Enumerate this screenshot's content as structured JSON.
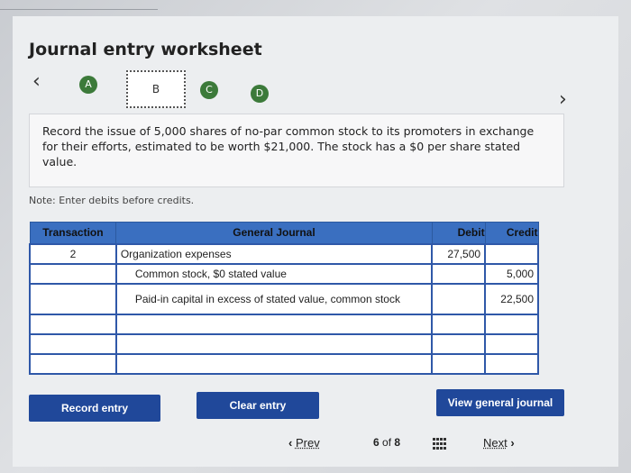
{
  "title": "Journal entry worksheet",
  "steps": [
    "A",
    "B",
    "C",
    "D"
  ],
  "instruction": "Record the issue of 5,000 shares of no-par common stock to its promoters in exchange for their efforts, estimated to be worth $21,000. The stock has a $0 per share stated value.",
  "note": "Note: Enter debits before credits.",
  "table": {
    "headers": [
      "Transaction",
      "General Journal",
      "Debit",
      "Credit"
    ],
    "rows": [
      {
        "txn": "2",
        "account": "Organization expenses",
        "debit": "27,500",
        "credit": ""
      },
      {
        "txn": "",
        "account": "Common stock, $0 stated value",
        "debit": "",
        "credit": "5,000"
      },
      {
        "txn": "",
        "account": "Paid-in capital in excess of stated value, common stock",
        "debit": "",
        "credit": "22,500"
      },
      {
        "txn": "",
        "account": "",
        "debit": "",
        "credit": ""
      },
      {
        "txn": "",
        "account": "",
        "debit": "",
        "credit": ""
      },
      {
        "txn": "",
        "account": "",
        "debit": "",
        "credit": ""
      }
    ]
  },
  "buttons": {
    "record": "Record entry",
    "clear": "Clear entry",
    "view": "View general journal"
  },
  "footer": {
    "prev": "Prev",
    "page": "6",
    "of": "of",
    "total": "8",
    "next": "Next"
  }
}
